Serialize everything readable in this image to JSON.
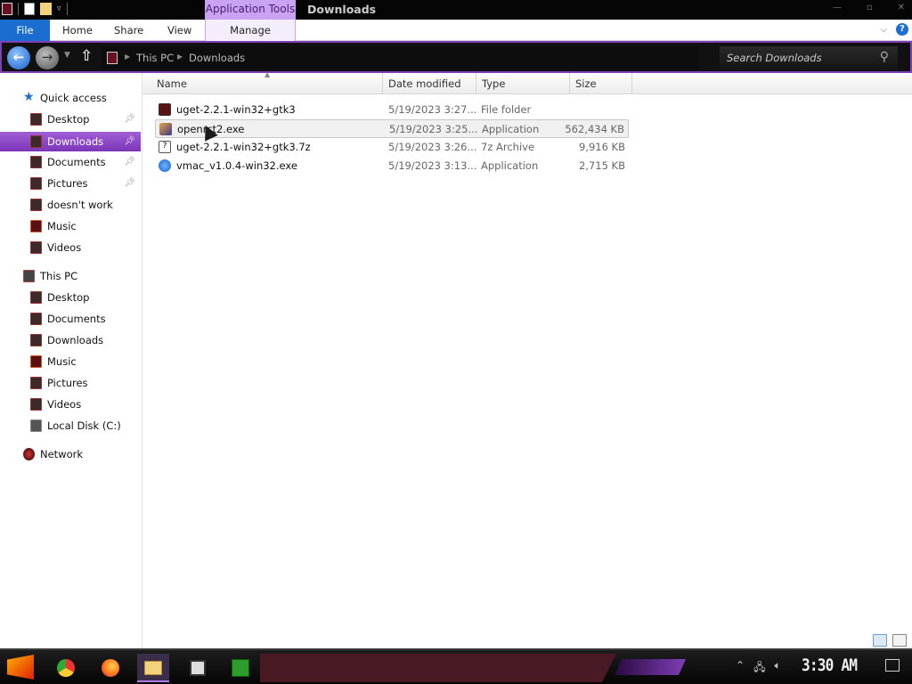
{
  "window": {
    "title": "Downloads",
    "context_tab": "Application Tools"
  },
  "ribbon": {
    "tabs": [
      "File",
      "Home",
      "Share",
      "View",
      "Manage"
    ]
  },
  "address": {
    "crumbs": [
      "This PC",
      "Downloads"
    ],
    "search_placeholder": "Search Downloads"
  },
  "nav": {
    "quick_access": "Quick access",
    "qa_items": [
      {
        "label": "Desktop",
        "icon": "desktop-icon"
      },
      {
        "label": "Downloads",
        "icon": "downloads-icon"
      },
      {
        "label": "Documents",
        "icon": "documents-icon"
      },
      {
        "label": "Pictures",
        "icon": "pictures-icon"
      },
      {
        "label": "doesn't work",
        "icon": "folder-icon"
      },
      {
        "label": "Music",
        "icon": "music-icon"
      },
      {
        "label": "Videos",
        "icon": "videos-icon"
      }
    ],
    "this_pc": "This PC",
    "pc_items": [
      {
        "label": "Desktop",
        "icon": "desktop-icon"
      },
      {
        "label": "Documents",
        "icon": "documents-icon"
      },
      {
        "label": "Downloads",
        "icon": "downloads-icon"
      },
      {
        "label": "Music",
        "icon": "music-icon"
      },
      {
        "label": "Pictures",
        "icon": "pictures-icon"
      },
      {
        "label": "Videos",
        "icon": "videos-icon"
      },
      {
        "label": "Local Disk (C:)",
        "icon": "disk-icon"
      }
    ],
    "network": "Network",
    "selected": "Downloads"
  },
  "columns": [
    "Name",
    "Date modified",
    "Type",
    "Size"
  ],
  "files": [
    {
      "name": "uget-2.2.1-win32+gtk3",
      "date": "5/19/2023 3:27...",
      "type": "File folder",
      "size": "",
      "icon": "folder-icon"
    },
    {
      "name": "openrct2.exe",
      "date": "5/19/2023 3:25...",
      "type": "Application",
      "size": "562,434 KB",
      "icon": "application-icon"
    },
    {
      "name": "uget-2.2.1-win32+gtk3.7z",
      "date": "5/19/2023 3:26...",
      "type": "7z Archive",
      "size": "9,916 KB",
      "icon": "archive-icon"
    },
    {
      "name": "vmac_v1.0.4-win32.exe",
      "date": "5/19/2023 3:13...",
      "type": "Application",
      "size": "2,715 KB",
      "icon": "vmac-icon"
    }
  ],
  "taskbar": {
    "clock": "3:30 AM"
  },
  "colors": {
    "accent": "#7e3fb8",
    "selection": "#8c44c8",
    "file_tab": "#1c6dd0"
  }
}
